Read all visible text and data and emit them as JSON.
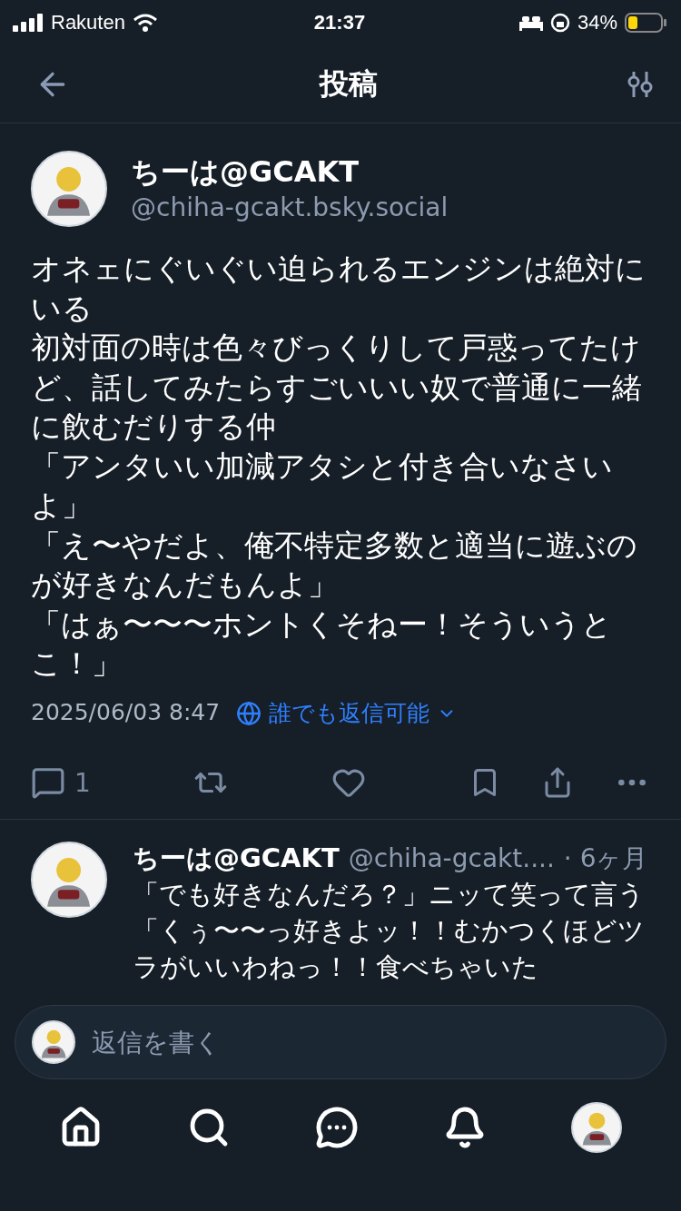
{
  "status_bar": {
    "carrier": "Rakuten",
    "time": "21:37",
    "battery": "34%"
  },
  "header": {
    "title": "投稿"
  },
  "post": {
    "author": "ちーは@GCAKT",
    "handle": "@chiha-gcakt.bsky.social",
    "paragraphs": [
      "オネェにぐいぐい迫られるエンジンは絶対にいる",
      "初対面の時は色々びっくりして戸惑ってたけど、話してみたらすごいいい奴で普通に一緒に飲むだりする仲",
      "「アンタいい加減アタシと付き合いなさいよ」",
      "「え〜やだよ、俺不特定多数と適当に遊ぶのが好きなんだもんよ」",
      "「はぁ〜〜〜ホントくそねー！そういうとこ！」"
    ],
    "date": "2025/06/03 8:47",
    "reply_setting": "誰でも返信可能",
    "reply_count": "1"
  },
  "reply": {
    "author": "ちーは@GCAKT",
    "handle": "@chiha-gcakt....",
    "age": "· 6ヶ月",
    "paragraphs": [
      "「でも好きなんだろ？」ニッて笑って言う",
      "「くぅ〜〜っ好きよッ！！むかつくほどツラがいいわねっ！！食べちゃいた"
    ]
  },
  "composer": {
    "placeholder": "返信を書く"
  },
  "tab_bar": [
    {
      "kind": "home",
      "selected": false
    },
    {
      "kind": "search",
      "selected": false
    },
    {
      "kind": "chat",
      "selected": false
    },
    {
      "kind": "notifications",
      "selected": false
    },
    {
      "kind": "profile",
      "selected": false
    }
  ]
}
